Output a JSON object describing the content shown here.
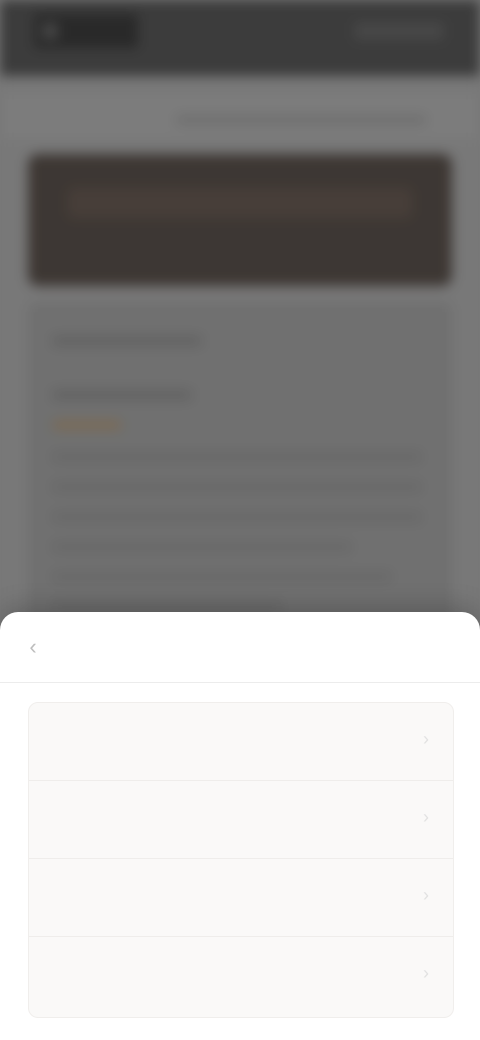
{
  "app": {
    "window_title": ""
  },
  "sheet": {
    "title": "",
    "back_icon": "back-arrow-icon",
    "options": [
      {
        "label": "",
        "icon": "chevron-right-icon"
      },
      {
        "label": "",
        "icon": "chevron-right-icon"
      },
      {
        "label": "",
        "icon": "chevron-right-icon"
      },
      {
        "label": "",
        "icon": "chevron-right-icon"
      }
    ]
  },
  "colors": {
    "topbar": "#2b2b2b",
    "hero": "#2d2520",
    "sheet_bg": "#ffffff",
    "option_bg": "#faf9f8"
  }
}
